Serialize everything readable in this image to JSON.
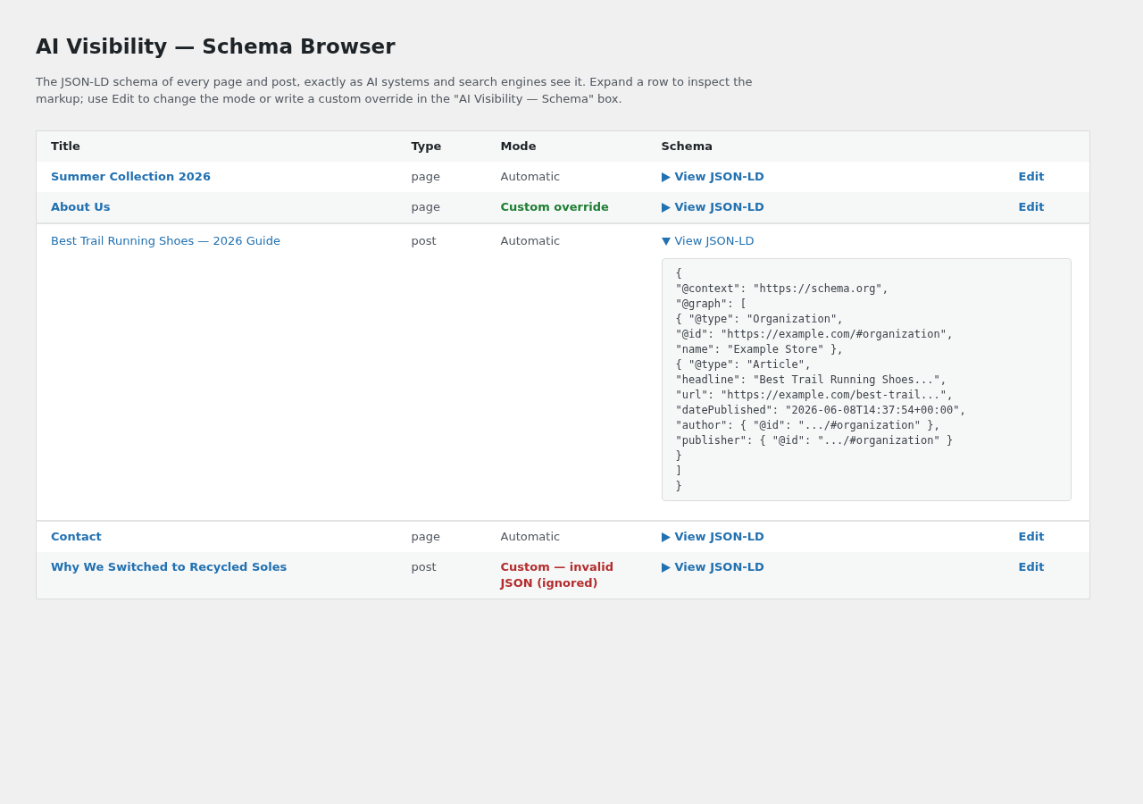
{
  "page": {
    "title": "AI Visibility — Schema Browser",
    "description": "The JSON-LD schema of every page and post, exactly as AI systems and search engines see it. Expand a row to inspect the markup; use Edit to change the mode or write a custom override in the \"AI Visibility — Schema\" box."
  },
  "table": {
    "columns": [
      "Title",
      "Type",
      "Mode",
      "Schema"
    ],
    "rows": [
      {
        "title": "Summer Collection 2026",
        "type": "page",
        "mode": {
          "kind": "automatic",
          "label": "Automatic"
        },
        "toggle": "View JSON-LD",
        "expanded": false,
        "edit": "Edit"
      },
      {
        "title": "About Us",
        "type": "page",
        "mode": {
          "kind": "custom",
          "label": "Custom override"
        },
        "toggle": "View JSON-LD",
        "expanded": false,
        "edit": "Edit"
      },
      {
        "title": "Best Trail Running Shoes — 2026 Guide",
        "type": "post",
        "mode": {
          "kind": "automatic",
          "label": "Automatic"
        },
        "toggle": "View JSON-LD",
        "expanded": true,
        "code_lines": [
          "{",
          "\"@context\": \"https://schema.org\",",
          "\"@graph\": [",
          "{ \"@type\": \"Organization\",",
          "\"@id\": \"https://example.com/#organization\",",
          "\"name\": \"Example Store\" },",
          "{ \"@type\": \"Article\",",
          "\"headline\": \"Best Trail Running Shoes...\",",
          "\"url\": \"https://example.com/best-trail...\",",
          "\"datePublished\": \"2026-06-08T14:37:54+00:00\",",
          "\"author\": { \"@id\": \".../#organization\" },",
          "\"publisher\": { \"@id\": \".../#organization\" }",
          "}",
          "]",
          "}"
        ]
      },
      {
        "title": "Contact",
        "type": "page",
        "mode": {
          "kind": "automatic",
          "label": "Automatic"
        },
        "toggle": "View JSON-LD",
        "expanded": false,
        "edit": "Edit"
      },
      {
        "title": "Why We Switched to Recycled Soles",
        "type": "post",
        "mode": {
          "kind": "invalid",
          "label": "Custom — invalid JSON (ignored)"
        },
        "toggle": "View JSON-LD",
        "expanded": false,
        "edit": "Edit"
      }
    ]
  }
}
